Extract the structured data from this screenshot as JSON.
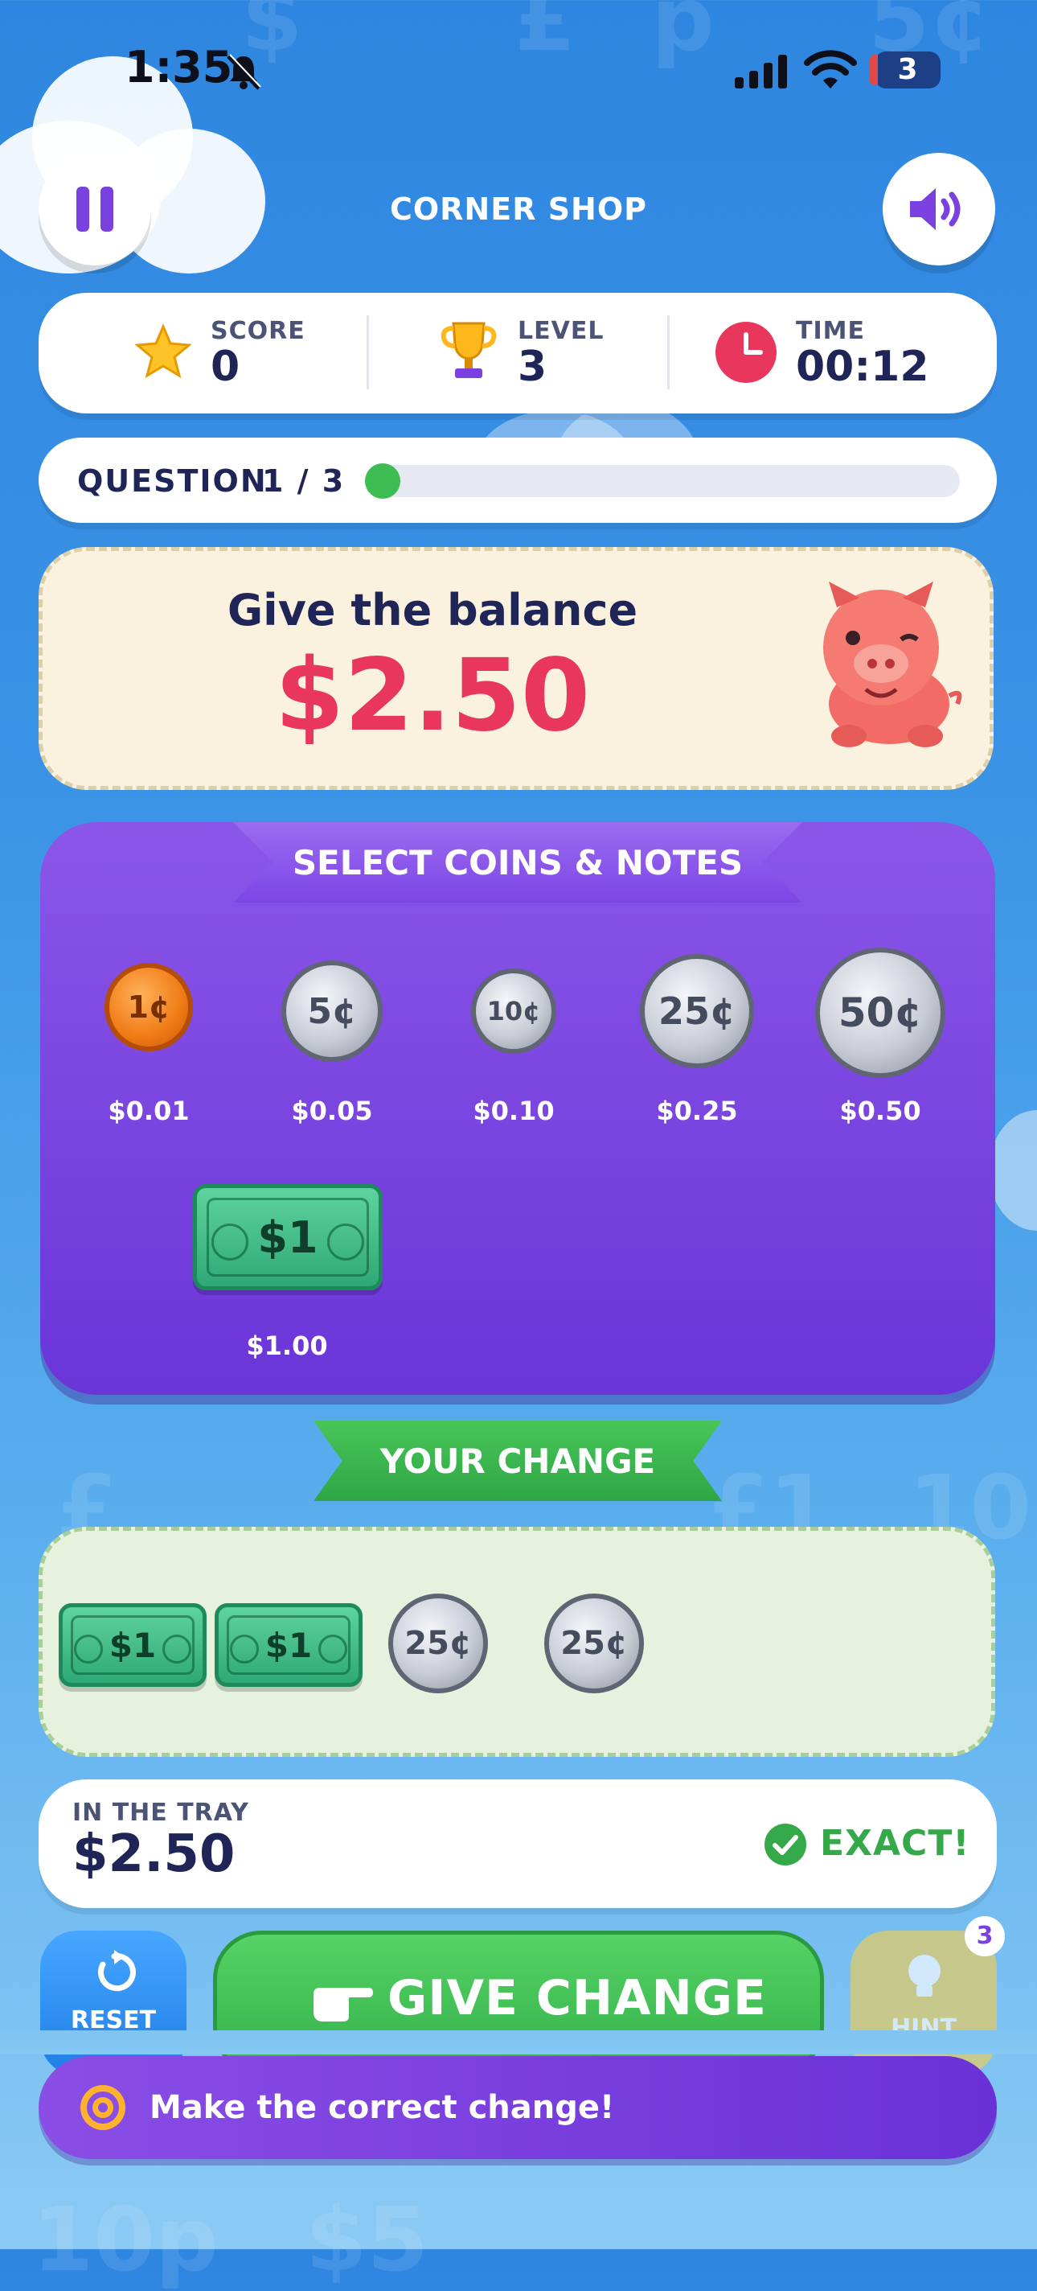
{
  "status_bar": {
    "time": "1:35",
    "battery": "3"
  },
  "header": {
    "title": "CORNER SHOP",
    "pause_icon": "pause-icon",
    "sound_icon": "speaker-icon"
  },
  "stats": {
    "score": {
      "label": "SCORE",
      "value": "0",
      "icon": "star-icon"
    },
    "level": {
      "label": "LEVEL",
      "value": "3",
      "icon": "trophy-icon"
    },
    "time": {
      "label": "TIME",
      "value": "00:12",
      "icon": "clock-icon"
    }
  },
  "progress": {
    "label": "QUESTION",
    "count": "1 / 3",
    "fraction": 0.04
  },
  "prompt": {
    "title": "Give the balance",
    "amount": "$2.50",
    "mascot": "piggy-bank"
  },
  "selector": {
    "title": "SELECT COINS & NOTES",
    "items": [
      {
        "face": "1¢",
        "value": "$0.01",
        "type": "coin",
        "metal": "copper"
      },
      {
        "face": "5¢",
        "value": "$0.05",
        "type": "coin",
        "metal": "silver"
      },
      {
        "face": "10¢",
        "value": "$0.10",
        "type": "coin",
        "metal": "silver"
      },
      {
        "face": "25¢",
        "value": "$0.25",
        "type": "coin",
        "metal": "silver"
      },
      {
        "face": "50¢",
        "value": "$0.50",
        "type": "coin",
        "metal": "silver"
      },
      {
        "face": "$1",
        "value": "$1.00",
        "type": "note"
      }
    ]
  },
  "change": {
    "title": "YOUR CHANGE",
    "items": [
      {
        "face": "$1",
        "type": "note"
      },
      {
        "face": "$1",
        "type": "note"
      },
      {
        "face": "25¢",
        "type": "coin"
      },
      {
        "face": "25¢",
        "type": "coin"
      }
    ]
  },
  "tray": {
    "label": "IN THE TRAY",
    "amount": "$2.50",
    "status": "EXACT!"
  },
  "actions": {
    "reset": "RESET",
    "give": "GIVE CHANGE",
    "hint": "HINT",
    "hint_count": "3"
  },
  "toast": {
    "message": "Make the correct change!"
  },
  "colors": {
    "accent": "#e8365d",
    "purple": "#7a40e0",
    "green": "#3cbc52",
    "blue": "#2f86e0"
  }
}
